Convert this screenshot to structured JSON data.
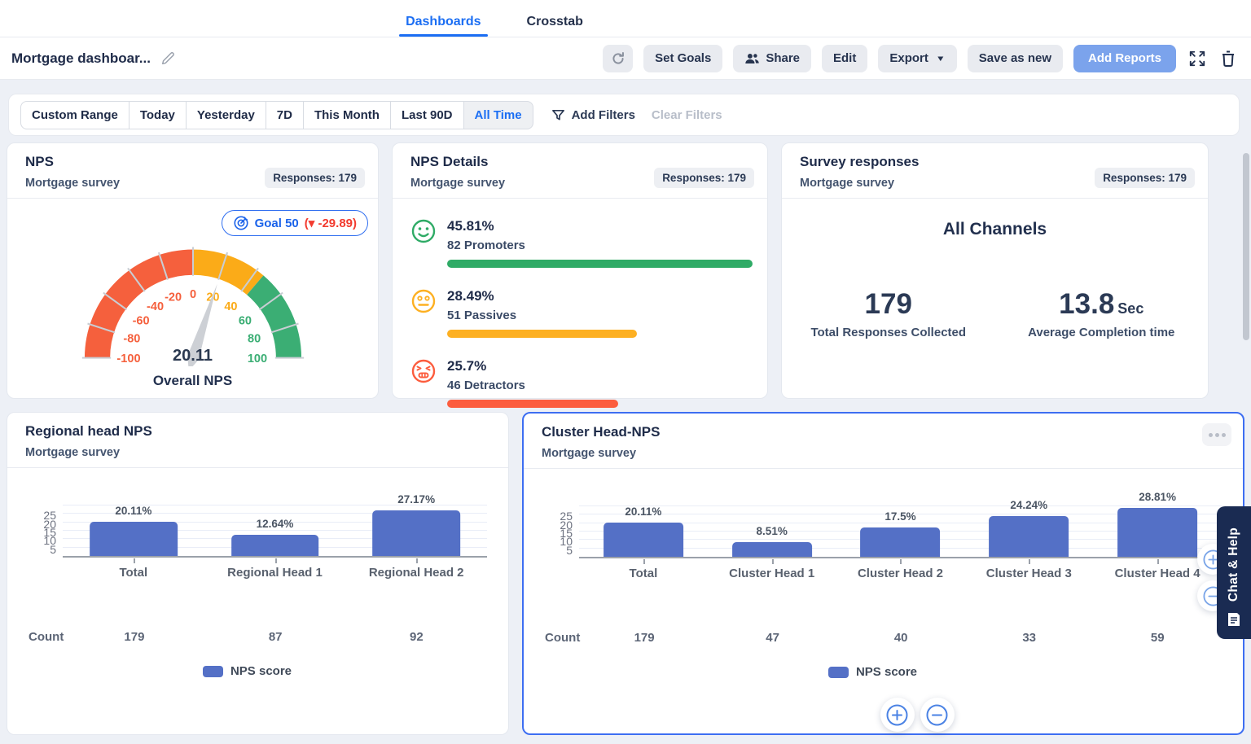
{
  "nav": {
    "tabs": [
      {
        "label": "Dashboards"
      },
      {
        "label": "Crosstab"
      }
    ],
    "active_tab": "Dashboards"
  },
  "toolbar": {
    "title": "Mortgage dashboar...",
    "set_goals": "Set Goals",
    "share": "Share",
    "edit": "Edit",
    "export": "Export",
    "save_as_new": "Save as new",
    "add_reports": "Add Reports"
  },
  "filters": {
    "ranges": [
      "Custom Range",
      "Today",
      "Yesterday",
      "7D",
      "This Month",
      "Last 90D",
      "All Time"
    ],
    "active_range": "All Time",
    "add_filters": "Add Filters",
    "clear_filters": "Clear Filters"
  },
  "colors": {
    "accent": "#1b6ef3",
    "add_reports_bg": "#7ba3ec",
    "bar_blue": "#5470c6",
    "promoter_green": "#2fab66",
    "passive_yellow": "#fdb022",
    "detractor_red": "#fc5d3e",
    "gauge_red": "#f5603d",
    "gauge_orange": "#fbab18",
    "gauge_green": "#3bae74",
    "chat_navy": "#1a2b52"
  },
  "cards": {
    "nps": {
      "title": "NPS",
      "subtitle": "Mortgage survey",
      "responses": "Responses: 179",
      "goal_label": "Goal 50",
      "goal_delta": "(▾ -29.89)"
    },
    "details": {
      "title": "NPS Details",
      "subtitle": "Mortgage survey",
      "responses": "Responses: 179"
    },
    "survey": {
      "title": "Survey responses",
      "subtitle": "Mortgage survey",
      "responses": "Responses: 179",
      "headline": "All Channels",
      "stat1_value": "179",
      "stat1_label": "Total Responses Collected",
      "stat2_value": "13.8",
      "stat2_unit": "Sec",
      "stat2_label": "Average Completion time"
    },
    "regional": {
      "title": "Regional head NPS",
      "subtitle": "Mortgage survey"
    },
    "cluster": {
      "title": "Cluster Head-NPS",
      "subtitle": "Mortgage survey"
    }
  },
  "chart_data": [
    {
      "id": "nps-gauge",
      "type": "gauge",
      "title": "Overall NPS",
      "min": -100,
      "max": 100,
      "value": 20.11,
      "value_label": "20.11",
      "ticks": [
        -100,
        -80,
        -60,
        -40,
        -20,
        0,
        20,
        40,
        60,
        80,
        100
      ],
      "segments": [
        {
          "from": -100,
          "to": 0,
          "color": "#f5603d"
        },
        {
          "from": 0,
          "to": 45,
          "color": "#fbab18"
        },
        {
          "from": 45,
          "to": 100,
          "color": "#3bae74"
        }
      ]
    },
    {
      "id": "nps-distribution",
      "type": "bar",
      "orientation": "horizontal",
      "rows": [
        {
          "pct": "45.81%",
          "value": 45.81,
          "label": "82 Promoters",
          "bar_pct": 100,
          "color": "#2fab66"
        },
        {
          "pct": "28.49%",
          "value": 28.49,
          "label": "51 Passives",
          "bar_pct": 62,
          "color": "#fdb022"
        },
        {
          "pct": "25.7%",
          "value": 25.7,
          "label": "46 Detractors",
          "bar_pct": 56,
          "color": "#fc5d3e"
        }
      ]
    },
    {
      "id": "regional",
      "type": "bar",
      "title": "Regional head NPS",
      "categories": [
        "Total",
        "Regional Head 1",
        "Regional Head 2"
      ],
      "values": [
        20.11,
        12.64,
        27.17
      ],
      "value_labels": [
        "20.11%",
        "12.64%",
        "27.17%"
      ],
      "counts": [
        "179",
        "87",
        "92"
      ],
      "count_label": "Count",
      "legend": "NPS score",
      "yticks": [
        5,
        10,
        15,
        20,
        25
      ],
      "ylim": [
        0,
        30
      ],
      "bar_color": "#5470c6"
    },
    {
      "id": "cluster",
      "type": "bar",
      "title": "Cluster Head-NPS",
      "categories": [
        "Total",
        "Cluster Head 1",
        "Cluster Head 2",
        "Cluster Head 3",
        "Cluster Head 4"
      ],
      "values": [
        20.11,
        8.51,
        17.5,
        24.24,
        28.81
      ],
      "value_labels": [
        "20.11%",
        "8.51%",
        "17.5%",
        "24.24%",
        "28.81%"
      ],
      "counts": [
        "179",
        "47",
        "40",
        "33",
        "59"
      ],
      "count_label": "Count",
      "legend": "NPS score",
      "yticks": [
        5,
        10,
        15,
        20,
        25
      ],
      "ylim": [
        0,
        30
      ],
      "bar_color": "#5470c6"
    }
  ],
  "overlay": {
    "chat_help": "Chat & Help"
  }
}
